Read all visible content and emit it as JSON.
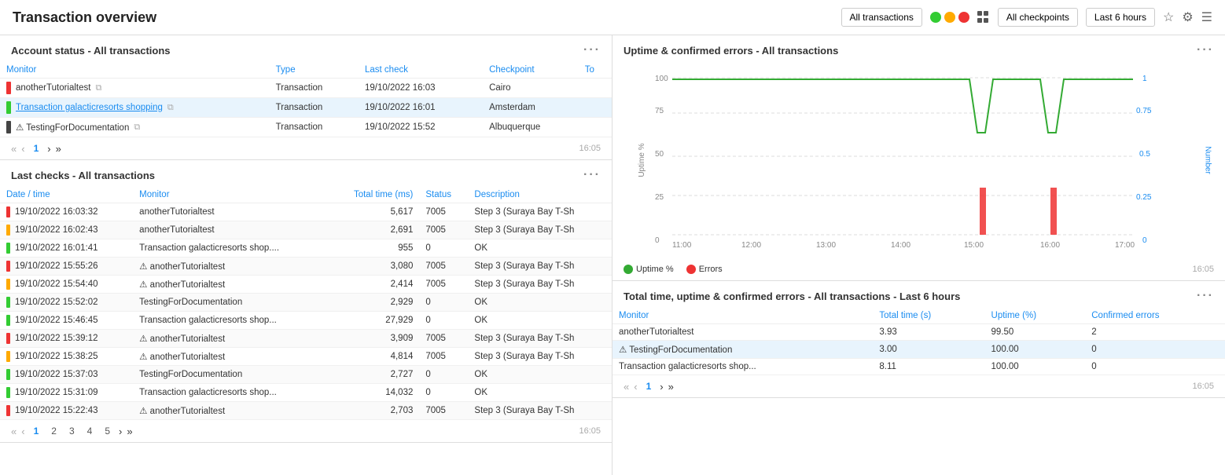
{
  "topbar": {
    "title": "Transaction overview",
    "btn_all_transactions": "All transactions",
    "btn_all_checkpoints": "All checkpoints",
    "btn_last_6h": "Last 6 hours"
  },
  "account_status": {
    "title": "Account status - All transactions",
    "columns": [
      "Monitor",
      "Type",
      "Last check",
      "Checkpoint",
      "To"
    ],
    "rows": [
      {
        "status": "red",
        "monitor": "anotherTutorialtest",
        "type": "Transaction",
        "last_check": "19/10/2022 16:03",
        "checkpoint": "Cairo",
        "highlighted": false
      },
      {
        "status": "green",
        "monitor": "Transaction galacticresorts shopping",
        "type": "Transaction",
        "last_check": "19/10/2022 16:01",
        "checkpoint": "Amsterdam",
        "highlighted": true
      },
      {
        "status": "dark",
        "monitor": "⚠ TestingForDocumentation",
        "type": "Transaction",
        "last_check": "19/10/2022 15:52",
        "checkpoint": "Albuquerque",
        "highlighted": false
      }
    ],
    "pagination": {
      "current": 1,
      "total_pages": 1,
      "timestamp": "16:05"
    }
  },
  "last_checks": {
    "title": "Last checks - All transactions",
    "columns": [
      "Date / time",
      "Monitor",
      "Total time (ms)",
      "Status",
      "Description"
    ],
    "rows": [
      {
        "status": "red",
        "datetime": "19/10/2022 16:03:32",
        "monitor": "anotherTutorialtest",
        "total_time": "5,617",
        "status_code": "7005",
        "description": "Step 3 (Suraya Bay T-Sh"
      },
      {
        "status": "orange",
        "datetime": "19/10/2022 16:02:43",
        "monitor": "anotherTutorialtest",
        "total_time": "2,691",
        "status_code": "7005",
        "description": "Step 3 (Suraya Bay T-Sh"
      },
      {
        "status": "green",
        "datetime": "19/10/2022 16:01:41",
        "monitor": "Transaction galacticresorts shop....",
        "total_time": "955",
        "status_code": "0",
        "description": "OK"
      },
      {
        "status": "red",
        "datetime": "19/10/2022 15:55:26",
        "monitor": "⚠ anotherTutorialtest",
        "total_time": "3,080",
        "status_code": "7005",
        "description": "Step 3 (Suraya Bay T-Sh"
      },
      {
        "status": "orange",
        "datetime": "19/10/2022 15:54:40",
        "monitor": "⚠ anotherTutorialtest",
        "total_time": "2,414",
        "status_code": "7005",
        "description": "Step 3 (Suraya Bay T-Sh"
      },
      {
        "status": "green",
        "datetime": "19/10/2022 15:52:02",
        "monitor": "TestingForDocumentation",
        "total_time": "2,929",
        "status_code": "0",
        "description": "OK"
      },
      {
        "status": "green",
        "datetime": "19/10/2022 15:46:45",
        "monitor": "Transaction galacticresorts shop...",
        "total_time": "27,929",
        "status_code": "0",
        "description": "OK"
      },
      {
        "status": "red",
        "datetime": "19/10/2022 15:39:12",
        "monitor": "⚠ anotherTutorialtest",
        "total_time": "3,909",
        "status_code": "7005",
        "description": "Step 3 (Suraya Bay T-Sh"
      },
      {
        "status": "orange",
        "datetime": "19/10/2022 15:38:25",
        "monitor": "⚠ anotherTutorialtest",
        "total_time": "4,814",
        "status_code": "7005",
        "description": "Step 3 (Suraya Bay T-Sh"
      },
      {
        "status": "green",
        "datetime": "19/10/2022 15:37:03",
        "monitor": "TestingForDocumentation",
        "total_time": "2,727",
        "status_code": "0",
        "description": "OK"
      },
      {
        "status": "green",
        "datetime": "19/10/2022 15:31:09",
        "monitor": "Transaction galacticresorts shop...",
        "total_time": "14,032",
        "status_code": "0",
        "description": "OK"
      },
      {
        "status": "red",
        "datetime": "19/10/2022 15:22:43",
        "monitor": "⚠ anotherTutorialtest",
        "total_time": "2,703",
        "status_code": "7005",
        "description": "Step 3 (Suraya Bay T-Sh"
      }
    ],
    "pagination": {
      "current": 1,
      "pages": [
        "1",
        "2",
        "3",
        "4",
        "5"
      ],
      "timestamp": "16:05"
    }
  },
  "uptime_chart": {
    "title": "Uptime & confirmed errors - All transactions",
    "x_labels": [
      "11:00",
      "12:00",
      "13:00",
      "14:00",
      "15:00",
      "16:00",
      "17:00"
    ],
    "y_left_labels": [
      "0",
      "25",
      "50",
      "75",
      "100"
    ],
    "y_right_labels": [
      "0",
      "0.25",
      "0.5",
      "0.75",
      "1"
    ],
    "y_axis_label": "Uptime %",
    "y_right_axis_label": "Number",
    "legend": [
      {
        "label": "Uptime %",
        "color": "#3a3"
      },
      {
        "label": "Errors",
        "color": "#e33"
      }
    ],
    "timestamp": "16:05"
  },
  "total_time_table": {
    "title": "Total time, uptime & confirmed errors - All transactions - Last 6 hours",
    "columns": [
      "Monitor",
      "Total time (s)",
      "Uptime (%)",
      "Confirmed errors"
    ],
    "rows": [
      {
        "monitor": "anotherTutorialtest",
        "total_time": "3.93",
        "uptime": "99.50",
        "confirmed_errors": "2",
        "highlighted": false
      },
      {
        "monitor": "⚠ TestingForDocumentation",
        "total_time": "3.00",
        "uptime": "100.00",
        "confirmed_errors": "0",
        "highlighted": true
      },
      {
        "monitor": "Transaction galacticresorts shop...",
        "total_time": "8.11",
        "uptime": "100.00",
        "confirmed_errors": "0",
        "highlighted": false
      }
    ],
    "pagination": {
      "current": 1,
      "timestamp": "16:05"
    }
  }
}
